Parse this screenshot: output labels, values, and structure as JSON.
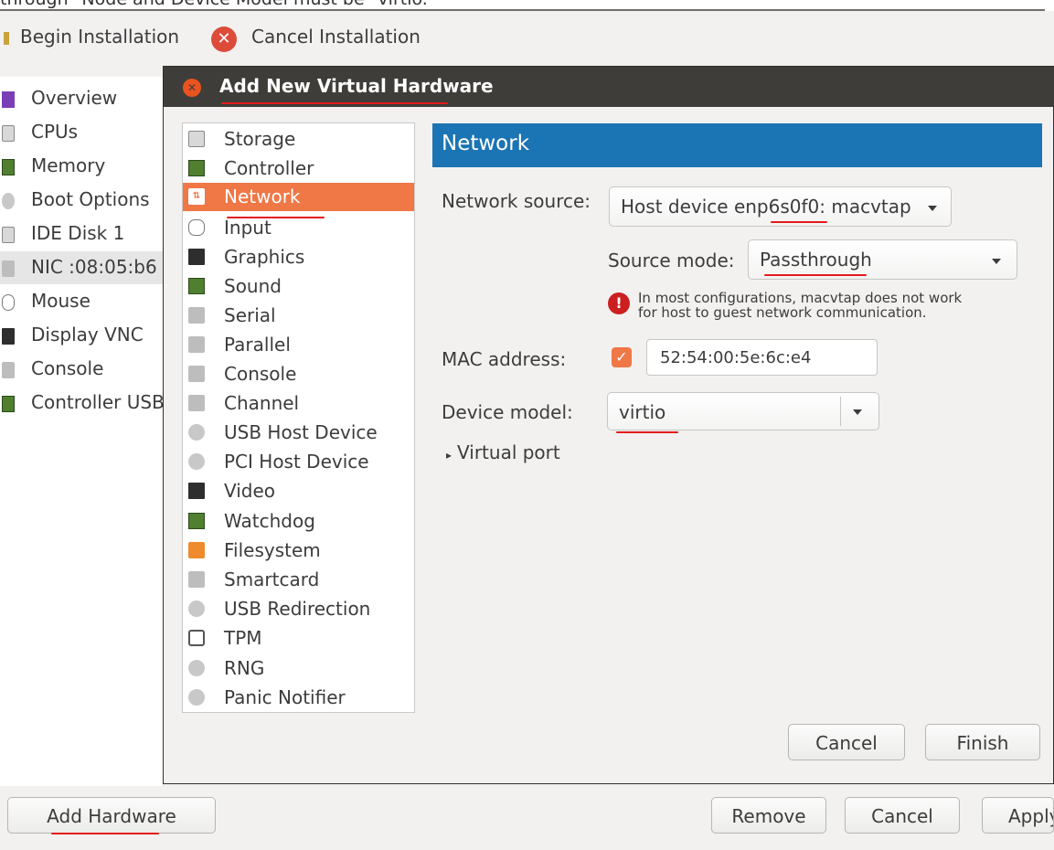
{
  "caption": "through \"Node and Device Model must be \"virtio.\"",
  "main_window": {
    "toolbar": {
      "begin_label": "Begin Installation",
      "cancel_label": "Cancel Installation"
    },
    "hardware_items": [
      {
        "label": "Overview",
        "icon": "overview-icon"
      },
      {
        "label": "CPUs",
        "icon": "cpu-icon"
      },
      {
        "label": "Memory",
        "icon": "memory-icon"
      },
      {
        "label": "Boot Options",
        "icon": "gear-icon"
      },
      {
        "label": "IDE Disk 1",
        "icon": "disk-icon"
      },
      {
        "label": "NIC :08:05:b6",
        "icon": "nic-icon"
      },
      {
        "label": "Mouse",
        "icon": "mouse-icon"
      },
      {
        "label": "Display VNC",
        "icon": "monitor-icon"
      },
      {
        "label": "Console",
        "icon": "console-icon"
      },
      {
        "label": "Controller USB",
        "icon": "controller-icon"
      }
    ],
    "buttons": {
      "add_hardware": "Add Hardware",
      "remove": "Remove",
      "cancel": "Cancel",
      "apply": "Apply"
    }
  },
  "dialog": {
    "title": "Add New Virtual Hardware",
    "device_types": [
      {
        "label": "Storage",
        "icon": "storage-icon"
      },
      {
        "label": "Controller",
        "icon": "controller-icon"
      },
      {
        "label": "Network",
        "icon": "network-icon",
        "selected": true
      },
      {
        "label": "Input",
        "icon": "mouse-icon"
      },
      {
        "label": "Graphics",
        "icon": "monitor-icon"
      },
      {
        "label": "Sound",
        "icon": "sound-icon"
      },
      {
        "label": "Serial",
        "icon": "serial-port-icon"
      },
      {
        "label": "Parallel",
        "icon": "parallel-port-icon"
      },
      {
        "label": "Console",
        "icon": "console-port-icon"
      },
      {
        "label": "Channel",
        "icon": "channel-port-icon"
      },
      {
        "label": "USB Host Device",
        "icon": "usb-icon"
      },
      {
        "label": "PCI Host Device",
        "icon": "pci-icon"
      },
      {
        "label": "Video",
        "icon": "video-icon"
      },
      {
        "label": "Watchdog",
        "icon": "watchdog-icon"
      },
      {
        "label": "Filesystem",
        "icon": "folder-icon"
      },
      {
        "label": "Smartcard",
        "icon": "smartcard-icon"
      },
      {
        "label": "USB Redirection",
        "icon": "usb-redirection-icon"
      },
      {
        "label": "TPM",
        "icon": "tpm-icon"
      },
      {
        "label": "RNG",
        "icon": "rng-icon"
      },
      {
        "label": "Panic Notifier",
        "icon": "panic-notifier-icon"
      }
    ],
    "section_title": "Network",
    "network_source_label": "Network source:",
    "network_source_value": "Host device enp6s0f0: macvtap",
    "source_mode_label": "Source mode:",
    "source_mode_value": "Passthrough",
    "warning_line1": "In most configurations, macvtap does not work",
    "warning_line2": "for host to guest network communication.",
    "mac_label": "MAC address:",
    "mac_checked": true,
    "mac_value": "52:54:00:5e:6c:e4",
    "device_model_label": "Device model:",
    "device_model_value": "virtio",
    "virtual_port_label": "Virtual port",
    "cancel_label": "Cancel",
    "finish_label": "Finish"
  },
  "colors": {
    "selection": "#f07746",
    "header_blue": "#1b74b3",
    "titlebar": "#3e3d39",
    "annotation_red": "#e31b1b",
    "close_red": "#dd4b39"
  }
}
